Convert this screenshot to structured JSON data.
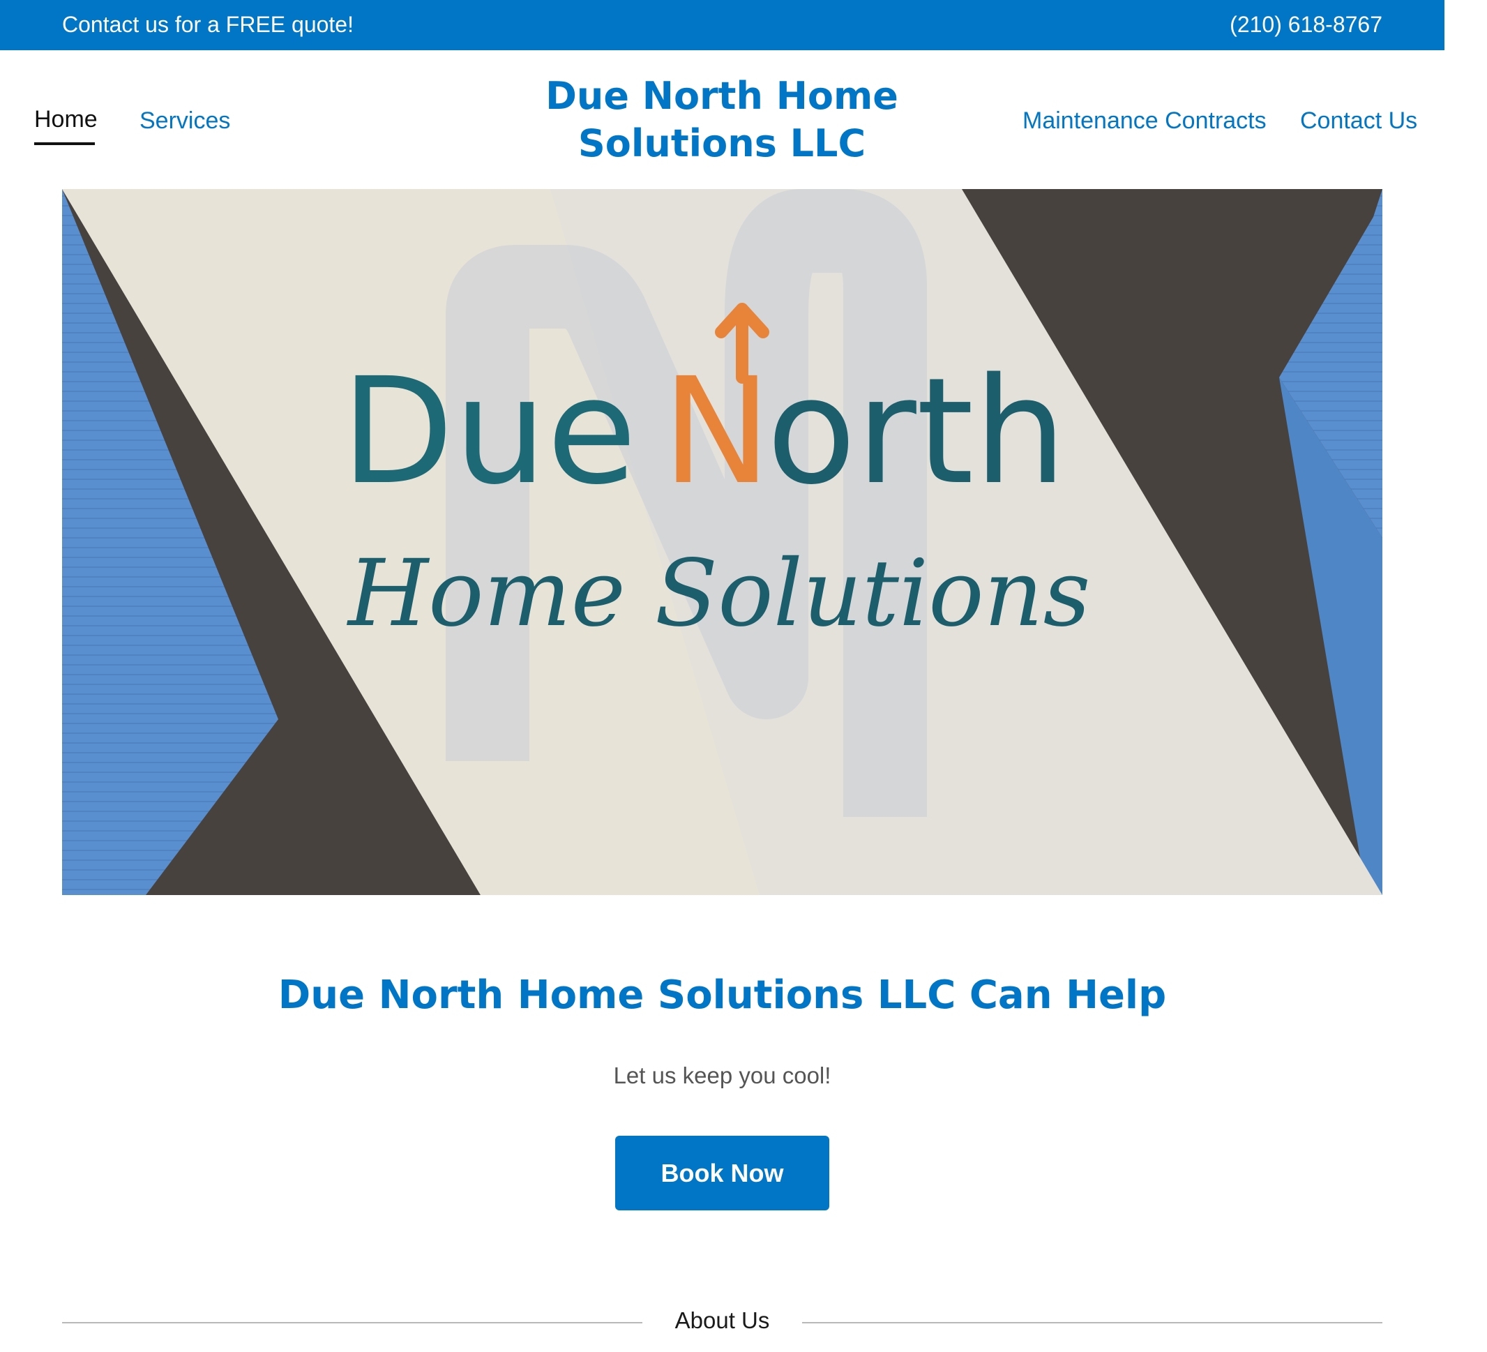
{
  "topbar": {
    "promo": "Contact us for a FREE quote!",
    "phone": "(210) 618-8767"
  },
  "nav": {
    "home": "Home",
    "services": "Services",
    "maintenance": "Maintenance Contracts",
    "contact": "Contact Us"
  },
  "brand": {
    "line1": "Due North Home",
    "line2": "Solutions LLC"
  },
  "hero": {
    "logo_word1": "Due",
    "logo_letter_n": "N",
    "logo_rest": "orth",
    "logo_subtitle": "Home Solutions",
    "colors": {
      "teal": "#1d6a76",
      "orange": "#e8833a",
      "blue": "#4f86c6",
      "dark": "#48433f",
      "paper": "#e8e3d6"
    }
  },
  "main": {
    "title": "Due North Home Solutions LLC Can Help",
    "tagline": "Let us keep you cool!",
    "book_label": "Book Now"
  },
  "about": {
    "label": "About Us"
  },
  "colors": {
    "accent": "#0176c6"
  }
}
